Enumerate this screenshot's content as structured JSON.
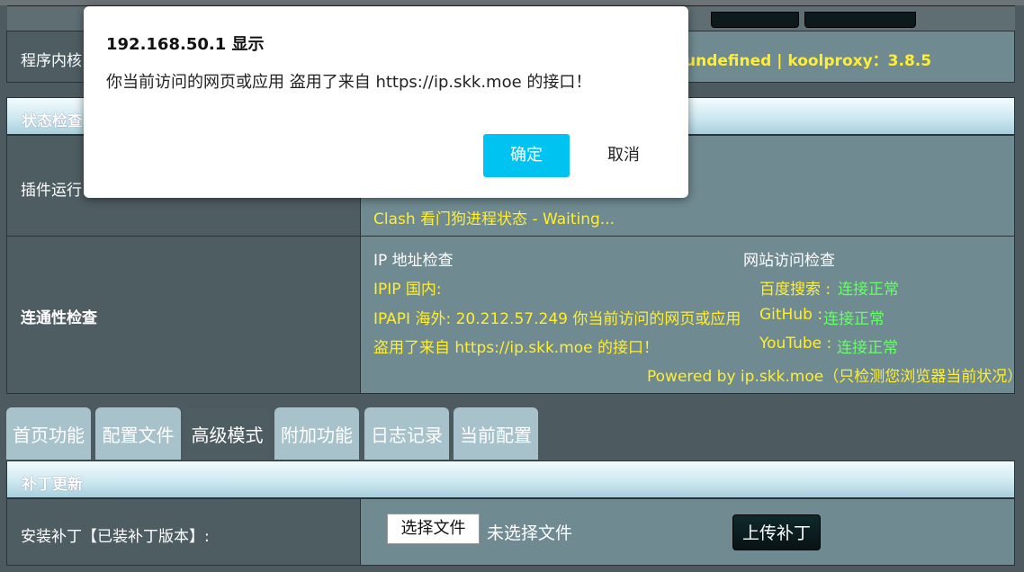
{
  "kernel_row": {
    "label": "程序内核",
    "value": "undefined | koolproxy：3.8.5"
  },
  "status_section": {
    "title": "状态检查",
    "plugin_label": "插件运行",
    "clash_status": "Clash 看门狗进程状态 - Waiting..."
  },
  "connectivity": {
    "label": "连通性检查",
    "ip_header": "IP 地址检查",
    "site_header": "网站访问检查",
    "ipip_line": "IPIP  国内:",
    "ipapi_line1": "IPAPI 海外: 20.212.57.249 你当前访问的网页或应用",
    "ipapi_line2": "盗用了来自 https://ip.skk.moe 的接口！",
    "sites": [
      {
        "name": "百度搜索 :",
        "status": "连接正常"
      },
      {
        "name": "GitHub :",
        "status": "连接正常"
      },
      {
        "name": "YouTube :",
        "status": "连接正常"
      }
    ],
    "powered_by": "Powered by ip.skk.moe（只检测您浏览器当前状况）"
  },
  "tabs": [
    {
      "label": "首页功能",
      "active": false
    },
    {
      "label": "配置文件",
      "active": false
    },
    {
      "label": "高级模式",
      "active": true
    },
    {
      "label": "附加功能",
      "active": false
    },
    {
      "label": "日志记录",
      "active": false
    },
    {
      "label": "当前配置",
      "active": false
    }
  ],
  "patch_section": {
    "title": "补丁更新",
    "install_label": "安装补丁【已装补丁版本】:",
    "choose_file": "选择文件",
    "no_file": "未选择文件",
    "upload": "上传补丁"
  },
  "dialog": {
    "title": "192.168.50.1 显示",
    "message": "你当前访问的网页或应用 盗用了来自 https://ip.skk.moe 的接口！",
    "ok": "确定",
    "cancel": "取消"
  },
  "colors": {
    "accent_ok_button": "#00c3f2",
    "status_yellow": "#ffee33",
    "status_green": "#66ff66"
  }
}
